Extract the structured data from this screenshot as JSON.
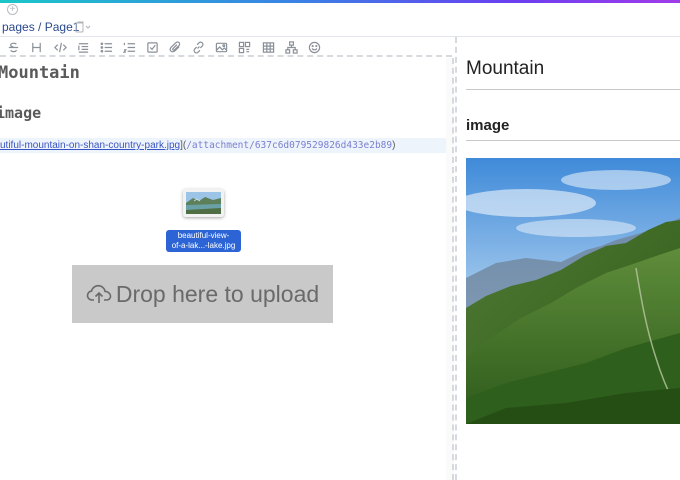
{
  "topbar": {
    "breadcrumb_pages": "pages",
    "breadcrumb_sep": " / ",
    "breadcrumb_page": "Page1"
  },
  "toolbar": {
    "icons": [
      "strikethrough-icon",
      "heading-icon",
      "code-icon",
      "blockquote-icon",
      "bullet-list-icon",
      "numbered-list-icon",
      "checklist-icon",
      "attachment-icon",
      "link-icon",
      "image-icon",
      "embed-icon",
      "table-icon",
      "diagram-icon",
      "emoji-icon"
    ]
  },
  "editor": {
    "h1": "Mountain",
    "h2": "image",
    "link_filename": "utiful-mountain-on-shan-country-park.jpg",
    "link_mid": "](",
    "link_attachment": "/attachment/637c6d079529826d433e2b89",
    "link_end": ")"
  },
  "drag": {
    "label_line1": "beautiful-view-",
    "label_line2": "of-a-lak...-lake.jpg"
  },
  "dropzone": {
    "text": "Drop here to upload"
  },
  "preview": {
    "h1": "Mountain",
    "h2": "image"
  },
  "colors": {
    "accent_start": "#1bc6c9",
    "accent_end": "#a13be8",
    "link": "#3a53c2",
    "drag_label_bg": "#2c64d6",
    "dropzone_bg": "#c9c9c9"
  }
}
